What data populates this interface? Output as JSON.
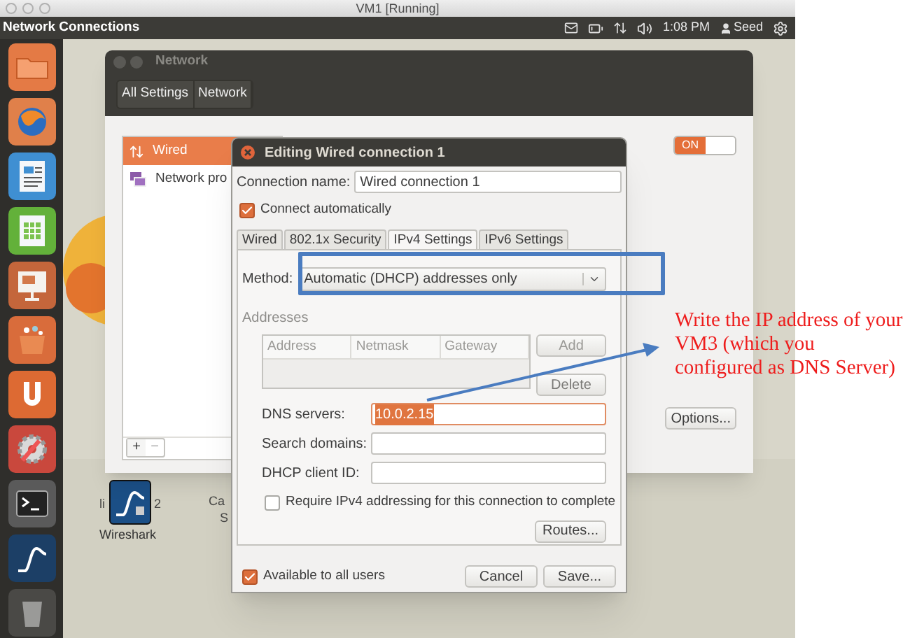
{
  "host_window": {
    "title": "VM1 [Running]"
  },
  "top_panel": {
    "app_name": "Network Connections",
    "time": "1:08 PM",
    "user": "Seed"
  },
  "desktop": {
    "icons": [
      {
        "label": "Wireshark"
      }
    ],
    "label_fragments": [
      {
        "text": "li"
      },
      {
        "text": "2"
      },
      {
        "text": "Ca"
      },
      {
        "text": "S"
      }
    ]
  },
  "network_window": {
    "title": "Network",
    "breadcrumbs": [
      "All Settings",
      "Network"
    ],
    "devices": [
      {
        "kind": "wired",
        "label": "Wired",
        "selected": true
      },
      {
        "kind": "proxy",
        "label": "Network pro",
        "selected": false
      }
    ],
    "list_buttons": [
      "+",
      "−"
    ],
    "switch": {
      "label": "ON",
      "on": true
    },
    "options_button": "Options..."
  },
  "dialog": {
    "title": "Editing Wired connection 1",
    "connection_name_label": "Connection name:",
    "connection_name": "Wired connection 1",
    "connect_automatically": {
      "label": "Connect automatically",
      "checked": true
    },
    "tabs": [
      {
        "label": "Wired",
        "selected": false
      },
      {
        "label": "802.1x Security",
        "selected": false
      },
      {
        "label": "IPv4 Settings",
        "selected": true
      },
      {
        "label": "IPv6 Settings",
        "selected": false
      }
    ],
    "method_label": "Method:",
    "method": "Automatic (DHCP) addresses only",
    "addresses_label": "Addresses",
    "address_columns": [
      "Address",
      "Netmask",
      "Gateway"
    ],
    "add_button": "Add",
    "delete_button": "Delete",
    "fields": [
      {
        "label": "DNS servers:",
        "value": "10.0.2.15",
        "highlighted": true
      },
      {
        "label": "Search domains:",
        "highlighted": false
      },
      {
        "label": "DHCP client ID:",
        "highlighted": false
      }
    ],
    "require_ipv4": {
      "label": "Require IPv4 addressing for this connection to complete",
      "checked": false
    },
    "routes_button": "Routes...",
    "available_to_all": {
      "label": "Available to all users",
      "checked": true
    },
    "buttons": [
      "Cancel",
      "Save..."
    ]
  },
  "annotation": {
    "text": "Write the IP address of your VM3 (which you configured as DNS Server)"
  }
}
